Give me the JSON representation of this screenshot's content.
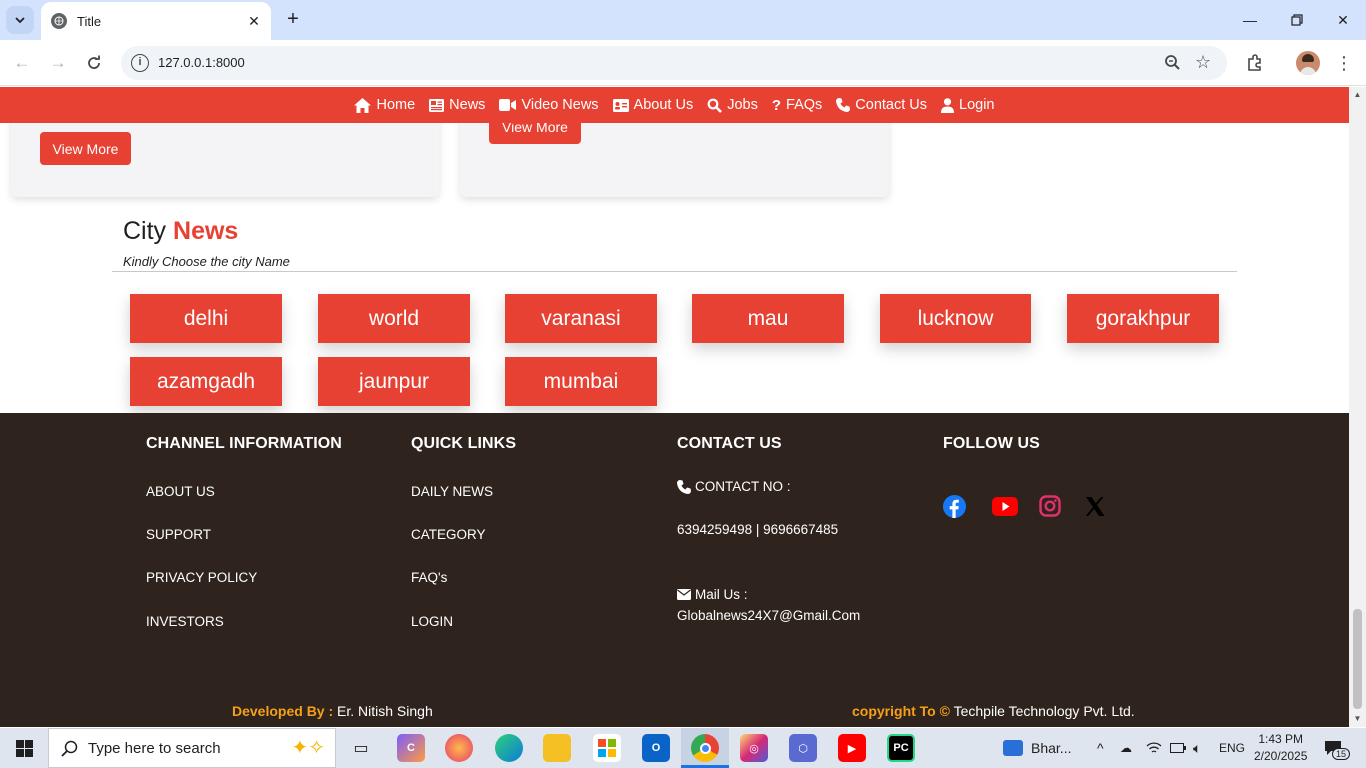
{
  "browser": {
    "tab_title": "Title",
    "url": "127.0.0.1:8000"
  },
  "nav": {
    "items": [
      {
        "label": "Home",
        "icon": "home-icon"
      },
      {
        "label": "News",
        "icon": "newspaper-icon"
      },
      {
        "label": "Video News",
        "icon": "video-icon"
      },
      {
        "label": "About Us",
        "icon": "id-card-icon"
      },
      {
        "label": "Jobs",
        "icon": "search-icon"
      },
      {
        "label": "FAQs",
        "icon": "question-icon"
      },
      {
        "label": "Contact Us",
        "icon": "phone-icon"
      },
      {
        "label": "Login",
        "icon": "user-icon"
      }
    ]
  },
  "cards": {
    "view_more_1": "View More",
    "view_more_2": "View More"
  },
  "city_section": {
    "title_plain": "City",
    "title_accent": "News",
    "subtitle": "Kindly Choose the city Name",
    "cities": [
      "delhi",
      "world",
      "varanasi",
      "mau",
      "lucknow",
      "gorakhpur",
      "azamgadh",
      "jaunpur",
      "mumbai"
    ]
  },
  "footer": {
    "channel_info": {
      "heading": "CHANNEL INFORMATION",
      "links": [
        "ABOUT US",
        "SUPPORT",
        "PRIVACY POLICY",
        "INVESTORS"
      ]
    },
    "quick_links": {
      "heading": "QUICK LINKS",
      "links": [
        "DAILY NEWS",
        "CATEGORY",
        "FAQ's",
        "LOGIN"
      ]
    },
    "contact": {
      "heading": "CONTACT US",
      "contact_label": "CONTACT NO :",
      "phones": "6394259498 | 9696667485",
      "mail_label": "Mail Us :",
      "email": "Globalnews24X7@Gmail.Com"
    },
    "follow": {
      "heading": "FOLLOW US",
      "icons": [
        "facebook-icon",
        "youtube-icon",
        "instagram-icon",
        "x-icon"
      ]
    },
    "developed_label": "Developed By :",
    "developer": "Er. Nitish Singh",
    "copyright_label": "copyright To ©",
    "company": "Techpile Technology Pvt. Ltd."
  },
  "taskbar": {
    "search_placeholder": "Type here to search",
    "weather": "Bhar...",
    "lang": "ENG",
    "time": "1:43 PM",
    "date": "2/20/2025",
    "notifications": "15"
  },
  "colors": {
    "brand_red": "#e74133",
    "footer_bg": "#2f231d",
    "accent_orange": "#f5a01a"
  }
}
